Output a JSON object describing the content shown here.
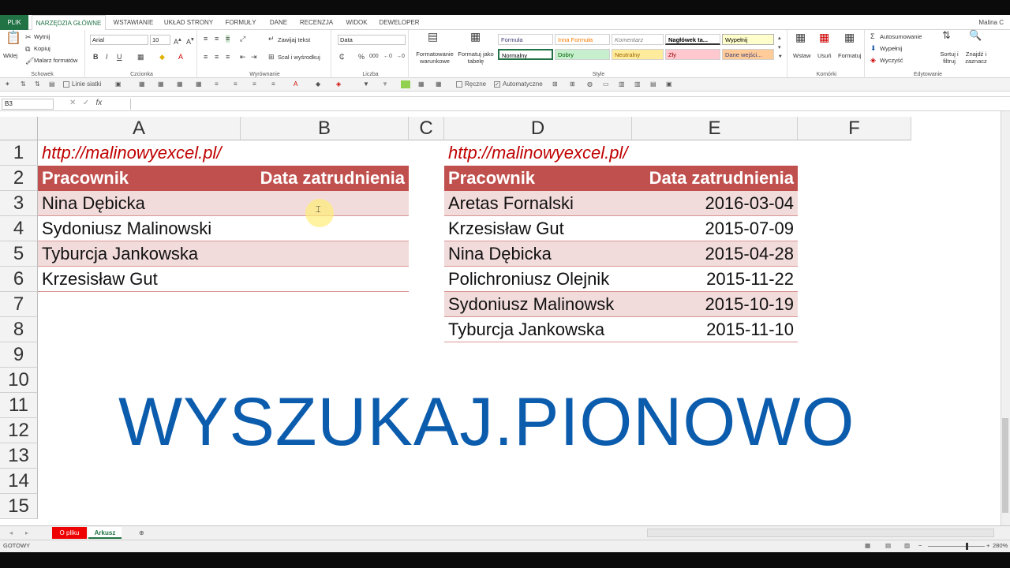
{
  "ribbon_tabs": [
    "PLIK",
    "NARZĘDZIA GŁÓWNE",
    "WSTAWIANIE",
    "UKŁAD STRONY",
    "FORMUŁY",
    "DANE",
    "RECENZJA",
    "WIDOK",
    "DEWELOPER"
  ],
  "user": "Malina C",
  "clipboard": {
    "paste": "Wklej",
    "cut": "Wytnij",
    "copy": "Kopiuj",
    "painter": "Malarz formatów",
    "label": "Schowek"
  },
  "font": {
    "name": "Arial",
    "size": "10",
    "label": "Czcionka"
  },
  "alignment": {
    "wrap": "Zawijaj tekst",
    "merge": "Scal i wyśrodkuj",
    "label": "Wyrównanie"
  },
  "number": {
    "format": "Data",
    "label": "Liczba"
  },
  "styles": {
    "cond": "Formatowanie warunkowe",
    "table": "Formatuj jako tabelę",
    "label": "Style",
    "items": [
      "Formuła",
      "Inna Formuła",
      "Komentarz",
      "Nagłówek ta...",
      "Wypełnij",
      "Normalny",
      "Dobry",
      "Neutralny",
      "Zły",
      "Dane wejści..."
    ]
  },
  "cells_group": {
    "insert": "Wstaw",
    "delete": "Usuń",
    "format": "Formatuj",
    "label": "Komórki"
  },
  "editing": {
    "autosum": "Autosumowanie",
    "fill": "Wypełnij",
    "clear": "Wyczyść",
    "sort": "Sortuj i filtruj",
    "find": "Znajdź i zaznacz",
    "label": "Edytowanie"
  },
  "qat": {
    "gridlines": "Linie siatki",
    "manual": "Ręczne",
    "auto": "Automatyczne"
  },
  "namebox": "B3",
  "columns": [
    "A",
    "B",
    "C",
    "D",
    "E",
    "F"
  ],
  "rows": [
    "1",
    "2",
    "3",
    "4",
    "5",
    "6",
    "7",
    "8",
    "9",
    "10",
    "11",
    "12",
    "13",
    "14",
    "15"
  ],
  "left_table": {
    "link": "http://malinowyexcel.pl/",
    "headers": [
      "Pracownik",
      "Data zatrudnienia"
    ],
    "rows": [
      "Nina Dębicka",
      "Sydoniusz Malinowski",
      "Tyburcja Jankowska",
      "Krzesisław Gut"
    ]
  },
  "right_table": {
    "link": "http://malinowyexcel.pl/",
    "headers": [
      "Pracownik",
      "Data zatrudnienia"
    ],
    "rows": [
      [
        "Aretas Fornalski",
        "2016-03-04"
      ],
      [
        "Krzesisław Gut",
        "2015-07-09"
      ],
      [
        "Nina Dębicka",
        "2015-04-28"
      ],
      [
        "Polichroniusz Olejnik",
        "2015-11-22"
      ],
      [
        "Sydoniusz Malinowsk",
        "2015-10-19"
      ],
      [
        "Tyburcja Jankowska",
        "2015-11-10"
      ]
    ]
  },
  "big_title": "WYSZUKAJ.PIONOWO",
  "sheets": [
    "O pliku",
    "Arkusz"
  ],
  "status": "GOTOWY",
  "zoom": "280%",
  "colors": {
    "accent": "#217346",
    "header": "#c0504d",
    "band": "#f2dcdb",
    "link": "#c00000",
    "title": "#0b5cad"
  }
}
